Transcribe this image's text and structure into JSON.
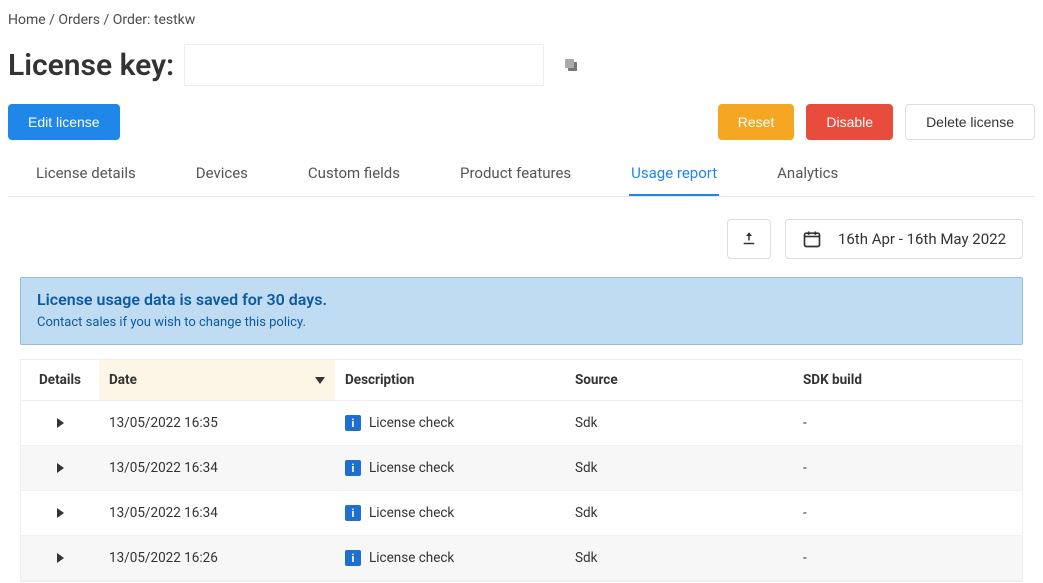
{
  "breadcrumb": {
    "home": "Home",
    "orders": "Orders",
    "current": "Order: testkw"
  },
  "header": {
    "label": "License key:",
    "value": ""
  },
  "actions": {
    "edit": "Edit license",
    "reset": "Reset",
    "disable": "Disable",
    "delete": "Delete license"
  },
  "tabs": {
    "license_details": "License details",
    "devices": "Devices",
    "custom_fields": "Custom fields",
    "product_features": "Product features",
    "usage_report": "Usage report",
    "analytics": "Analytics"
  },
  "toolbar": {
    "date_range": "16th Apr - 16th May 2022"
  },
  "banner": {
    "title": "License usage data is saved for 30 days.",
    "subtext": "Contact sales if you wish to change this policy."
  },
  "table": {
    "headers": {
      "details": "Details",
      "date": "Date",
      "description": "Description",
      "source": "Source",
      "sdk_build": "SDK build"
    },
    "rows": [
      {
        "date": "13/05/2022 16:35",
        "description": "License check",
        "source": "Sdk",
        "sdk_build": "-"
      },
      {
        "date": "13/05/2022 16:34",
        "description": "License check",
        "source": "Sdk",
        "sdk_build": "-"
      },
      {
        "date": "13/05/2022 16:34",
        "description": "License check",
        "source": "Sdk",
        "sdk_build": "-"
      },
      {
        "date": "13/05/2022 16:26",
        "description": "License check",
        "source": "Sdk",
        "sdk_build": "-"
      }
    ]
  }
}
